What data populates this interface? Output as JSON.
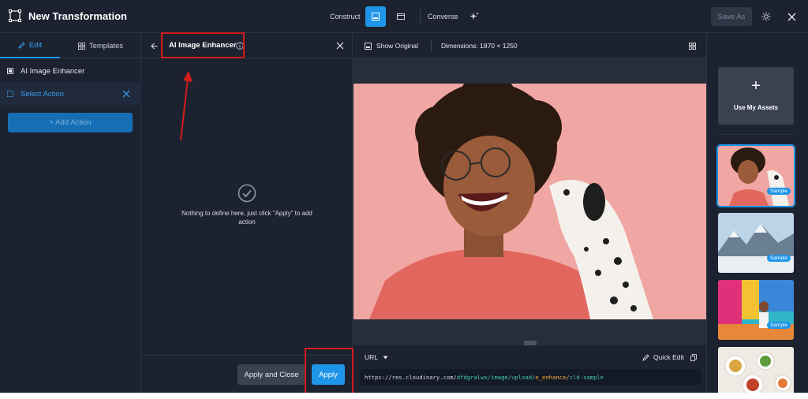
{
  "header": {
    "title": "New Transformation",
    "modes": {
      "construct_label": "Construct",
      "converse_label": "Converse"
    },
    "save_as_label": "Save As"
  },
  "left_panel": {
    "tabs": [
      {
        "label": "Edit",
        "active": true
      },
      {
        "label": "Templates",
        "active": false
      }
    ],
    "actions": [
      {
        "label": "AI Image Enhancer"
      },
      {
        "label": "Select Action",
        "selected": true
      }
    ],
    "add_action_label": "+ Add Action"
  },
  "middle_panel": {
    "title": "AI Image Enhancer",
    "empty_message": "Nothing to define here, just click \"Apply\" to add action",
    "apply_close_label": "Apply and Close",
    "apply_label": "Apply"
  },
  "canvas": {
    "show_original_label": "Show Original",
    "dimensions_text": "Dimensions: 1870 × 1250",
    "url_label": "URL",
    "quick_edit_label": "Quick Edit",
    "url": {
      "prefix": "https://res.cloudinary.com/",
      "cloud": "dfdgralwx/image/upload/",
      "transform": "e_enhance/",
      "public_id": "cld-sample"
    }
  },
  "assets_panel": {
    "use_my_assets_label": "Use My Assets",
    "use_my_assets_icon": "+",
    "badge_label": "Sample",
    "thumbnails": [
      {
        "name": "woman-with-dog",
        "badge": true,
        "selected": true
      },
      {
        "name": "snowy-mountains",
        "badge": true,
        "selected": false
      },
      {
        "name": "colorful-street",
        "badge": true,
        "selected": false
      },
      {
        "name": "food-table",
        "badge": false,
        "selected": false
      }
    ]
  },
  "colors": {
    "background": "#1c2230",
    "accent": "#1e95e8",
    "annotation_red": "#d21c1c",
    "url_cloud": "#43c7b4",
    "url_transform": "#f2a93b"
  }
}
